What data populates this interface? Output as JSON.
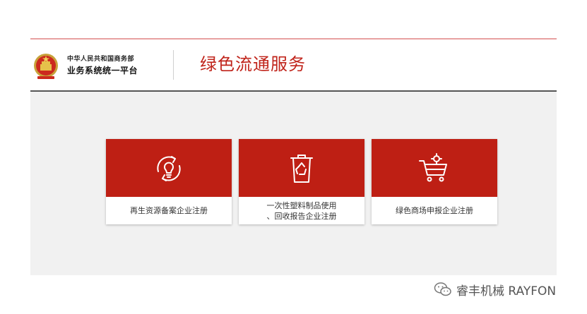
{
  "header": {
    "org_line1": "中华人民共和国商务部",
    "org_line2": "业务系统统一平台",
    "service_title": "绿色流通服务"
  },
  "cards": [
    {
      "label": "再生资源备案企业注册",
      "icon": "recycle-bulb-icon"
    },
    {
      "label_line1": "一次性塑料制品使用",
      "label_line2": "、回收报告企业注册",
      "icon": "recycle-bin-icon"
    },
    {
      "label": "绿色商场申报企业注册",
      "icon": "shopping-cart-icon"
    }
  ],
  "watermark": {
    "text": "睿丰机械 RAYFON",
    "icon": "wechat-icon"
  },
  "colors": {
    "brand_red": "#be1f14",
    "title_red": "#c0241b",
    "background": "#f1f1f1"
  }
}
